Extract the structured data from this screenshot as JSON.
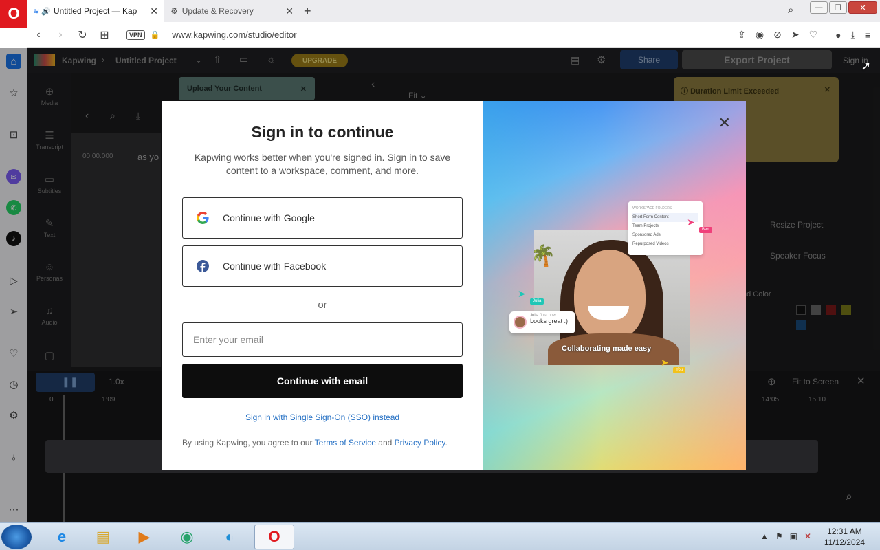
{
  "browser": {
    "tabs": [
      {
        "title": "Untitled Project — Kap",
        "active": true
      },
      {
        "title": "Update & Recovery",
        "active": false
      }
    ],
    "new_tab": "+",
    "url": "www.kapwing.com/studio/editor",
    "vpn_label": "VPN",
    "window_controls": {
      "minimize": "—",
      "maximize": "❐",
      "close": "✕"
    }
  },
  "app_background": {
    "brand": "Kapwing",
    "project_name": "Untitled Project",
    "upgrade": "UPGRADE",
    "share": "Share",
    "export": "Export Project",
    "sign_in": "Sign in",
    "upload_tip": "Upload Your Content",
    "duration_tip": "Duration Limit Exceeded",
    "left_tools": [
      "Media",
      "Transcript",
      "Subtitles",
      "Text",
      "Personas",
      "Audio"
    ],
    "timecode": "00:00.000",
    "transcript_snippet": "as yo",
    "fit_label": "Fit",
    "speed": "1.0x",
    "fit_to_screen": "Fit to Screen",
    "timeline_ticks": [
      "0",
      "1:09",
      "14:05",
      "15:10"
    ],
    "resize_project": "Resize Project",
    "speaker_focus": "Speaker Focus",
    "bg_color_label": "nd Color"
  },
  "modal": {
    "title": "Sign in to continue",
    "subtitle": "Kapwing works better when you're signed in. Sign in to save content to a workspace, comment, and more.",
    "google_label": "Continue with Google",
    "facebook_label": "Continue with Facebook",
    "or_label": "or",
    "email_placeholder": "Enter your email",
    "email_button": "Continue with email",
    "sso_link": "Sign in with Single Sign-On (SSO) instead",
    "legal_prefix": "By using Kapwing, you agree to our",
    "terms_link": "Terms of Service",
    "and": "and",
    "privacy_link": "Privacy Policy",
    "legal_suffix": ".",
    "close_label": "✕",
    "illustration": {
      "caption": "Collaborating made easy",
      "folders_header": "WORKSPACE FOLDERS",
      "folders": [
        "Short Form Content",
        "Team Projects",
        "Sponsored Ads",
        "Repurposed Videos"
      ],
      "comment_author": "Julia",
      "comment_time": "Just now",
      "comment_text": "Looks great :)",
      "tag_julia": "Julia",
      "tag_ben": "Ben",
      "tag_you": "You"
    }
  },
  "taskbar": {
    "time": "12:31 AM",
    "date": "11/12/2024"
  },
  "colors": {
    "opera_red": "#e0191f",
    "link_blue": "#2570c4",
    "email_button_bg": "#0d0d0d"
  }
}
